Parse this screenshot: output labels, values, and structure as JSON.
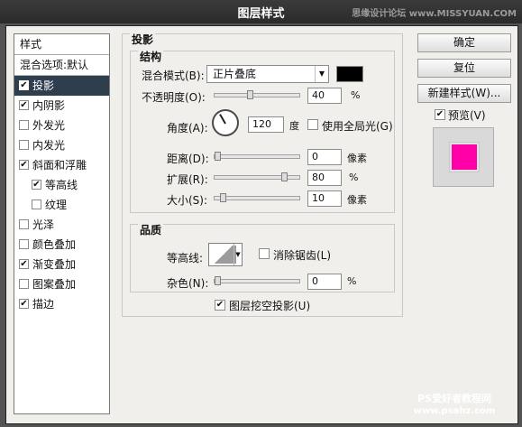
{
  "window": {
    "title": "图层样式"
  },
  "watermark_top": "思缘设计论坛 www.MISSYUAN.COM",
  "watermark_bottom": {
    "line1": "PS爱好者教程网",
    "line2": "www.psahz.com"
  },
  "left": {
    "title": "样式",
    "header": "混合选项:默认",
    "items": [
      {
        "label": "投影",
        "checked": true,
        "selected": true,
        "sub": false
      },
      {
        "label": "内阴影",
        "checked": true,
        "selected": false,
        "sub": false
      },
      {
        "label": "外发光",
        "checked": false,
        "selected": false,
        "sub": false
      },
      {
        "label": "内发光",
        "checked": false,
        "selected": false,
        "sub": false
      },
      {
        "label": "斜面和浮雕",
        "checked": true,
        "selected": false,
        "sub": false
      },
      {
        "label": "等高线",
        "checked": true,
        "selected": false,
        "sub": true
      },
      {
        "label": "纹理",
        "checked": false,
        "selected": false,
        "sub": true
      },
      {
        "label": "光泽",
        "checked": false,
        "selected": false,
        "sub": false
      },
      {
        "label": "颜色叠加",
        "checked": false,
        "selected": false,
        "sub": false
      },
      {
        "label": "渐变叠加",
        "checked": true,
        "selected": false,
        "sub": false
      },
      {
        "label": "图案叠加",
        "checked": false,
        "selected": false,
        "sub": false
      },
      {
        "label": "描边",
        "checked": true,
        "selected": false,
        "sub": false
      }
    ]
  },
  "shadow": {
    "title": "投影",
    "structure": {
      "title": "结构",
      "blend_mode_label": "混合模式(B):",
      "blend_mode_value": "正片叠底",
      "opacity_label": "不透明度(O):",
      "opacity_value": "40",
      "opacity_unit": "%",
      "angle_label": "角度(A):",
      "angle_value": "120",
      "angle_unit": "度",
      "global_light_label": "使用全局光(G)",
      "distance_label": "距离(D):",
      "distance_value": "0",
      "distance_unit": "像素",
      "spread_label": "扩展(R):",
      "spread_value": "80",
      "spread_unit": "%",
      "size_label": "大小(S):",
      "size_value": "10",
      "size_unit": "像素"
    },
    "quality": {
      "title": "品质",
      "contour_label": "等高线:",
      "anti_alias_label": "消除锯齿(L)",
      "noise_label": "杂色(N):",
      "noise_value": "0",
      "noise_unit": "%"
    },
    "knockout_label": "图层挖空投影(U)"
  },
  "buttons": {
    "ok": "确定",
    "reset": "复位",
    "new_style": "新建样式(W)...",
    "preview": "预览(V)"
  },
  "colors": {
    "shadow_color": "#000000",
    "preview_swatch": "#ff00a8",
    "selected_bg": "#2f3e4d"
  }
}
